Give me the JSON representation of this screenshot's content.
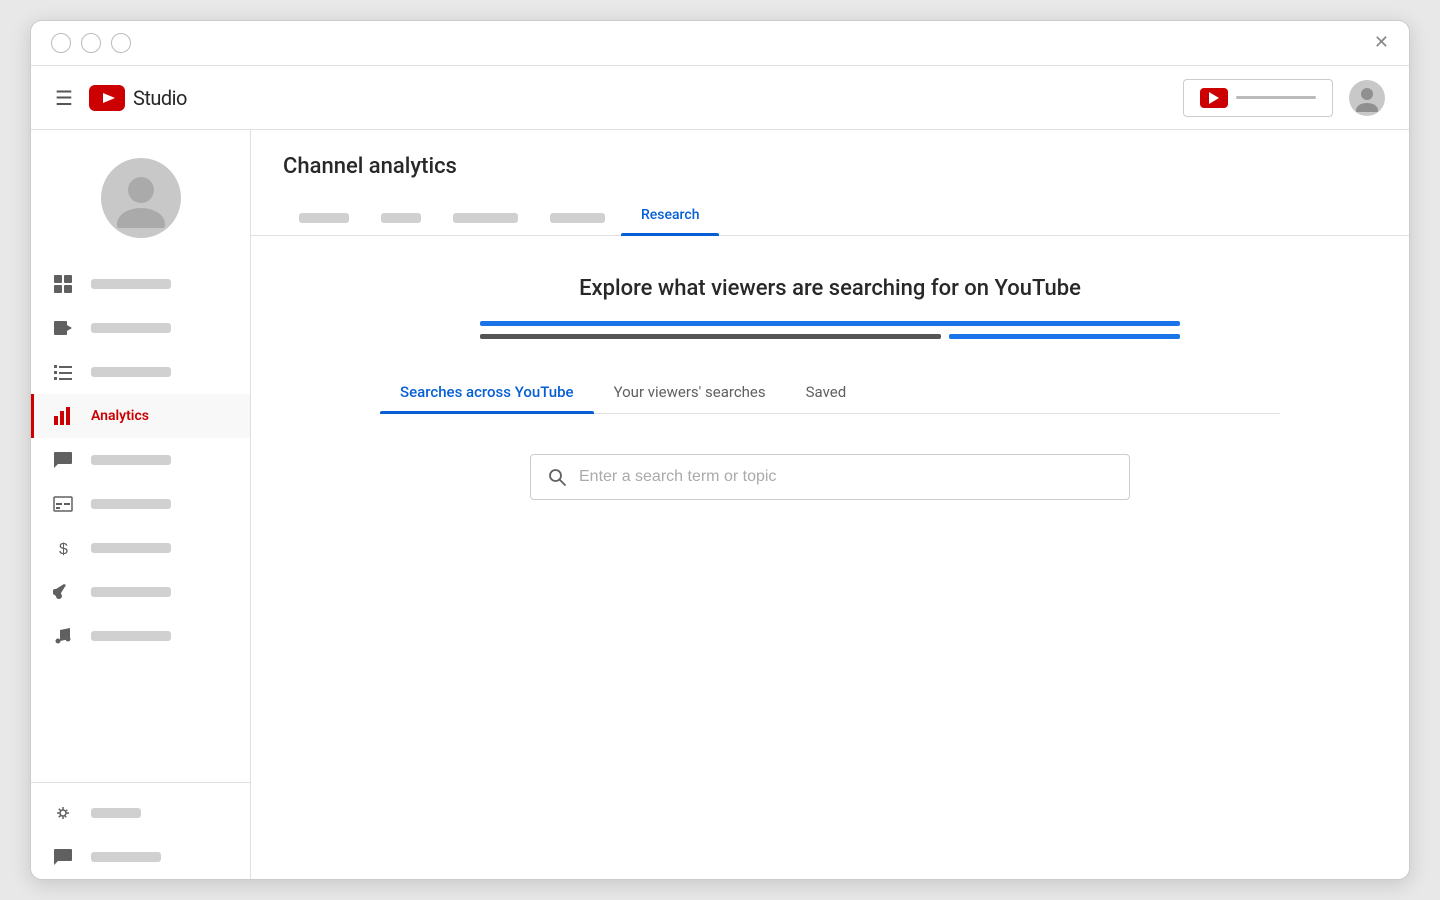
{
  "window": {
    "close_label": "✕"
  },
  "header": {
    "hamburger": "☰",
    "logo_text": "Studio",
    "create_label": "",
    "avatar_alt": "User avatar"
  },
  "sidebar": {
    "nav_items": [
      {
        "id": "dashboard",
        "label": "",
        "icon": "dashboard"
      },
      {
        "id": "content",
        "label": "",
        "icon": "video"
      },
      {
        "id": "playlists",
        "label": "",
        "icon": "list"
      },
      {
        "id": "analytics",
        "label": "Analytics",
        "icon": "analytics",
        "active": true
      },
      {
        "id": "comments",
        "label": "",
        "icon": "comment"
      },
      {
        "id": "subtitles",
        "label": "",
        "icon": "subtitles"
      },
      {
        "id": "monetization",
        "label": "",
        "icon": "dollar"
      },
      {
        "id": "customization",
        "label": "",
        "icon": "brush"
      },
      {
        "id": "audioLibrary",
        "label": "",
        "icon": "music"
      }
    ],
    "bottom_items": [
      {
        "id": "settings",
        "label": "",
        "icon": "gear"
      },
      {
        "id": "feedback",
        "label": "",
        "icon": "feedback"
      }
    ]
  },
  "page": {
    "title": "Channel analytics",
    "tabs": [
      {
        "id": "overview",
        "label": "",
        "active": false
      },
      {
        "id": "reach",
        "label": "",
        "active": false
      },
      {
        "id": "engagement",
        "label": "",
        "active": false
      },
      {
        "id": "audience",
        "label": "",
        "active": false
      },
      {
        "id": "research",
        "label": "Research",
        "active": true
      }
    ]
  },
  "research": {
    "heading": "Explore what viewers are searching for on YouTube",
    "sub_tabs": [
      {
        "id": "searches-across-yt",
        "label": "Searches across YouTube",
        "active": true
      },
      {
        "id": "your-viewers-searches",
        "label": "Your viewers' searches",
        "active": false
      },
      {
        "id": "saved",
        "label": "Saved",
        "active": false
      }
    ],
    "search_placeholder": "Enter a search term or topic"
  }
}
